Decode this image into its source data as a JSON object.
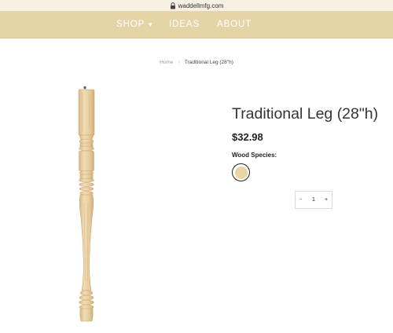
{
  "browser": {
    "url": "waddellmfg.com"
  },
  "nav": {
    "shop_label": "SHOP",
    "ideas_label": "IDEAS",
    "about_label": "ABOUT"
  },
  "breadcrumb": {
    "home": "Home",
    "current": "Traditional Leg (28\"h)"
  },
  "product": {
    "title": "Traditional Leg (28\"h)",
    "price": "$32.98",
    "wood_species_label": "Wood Species:",
    "swatch_color": "#e9d4a6"
  },
  "quantity": {
    "minus": "-",
    "value": "1",
    "plus": "+"
  },
  "colors": {
    "nav_bg": "#e4d4a6",
    "url_bg": "#f7f1e4",
    "wood": "#e9d2a8"
  }
}
